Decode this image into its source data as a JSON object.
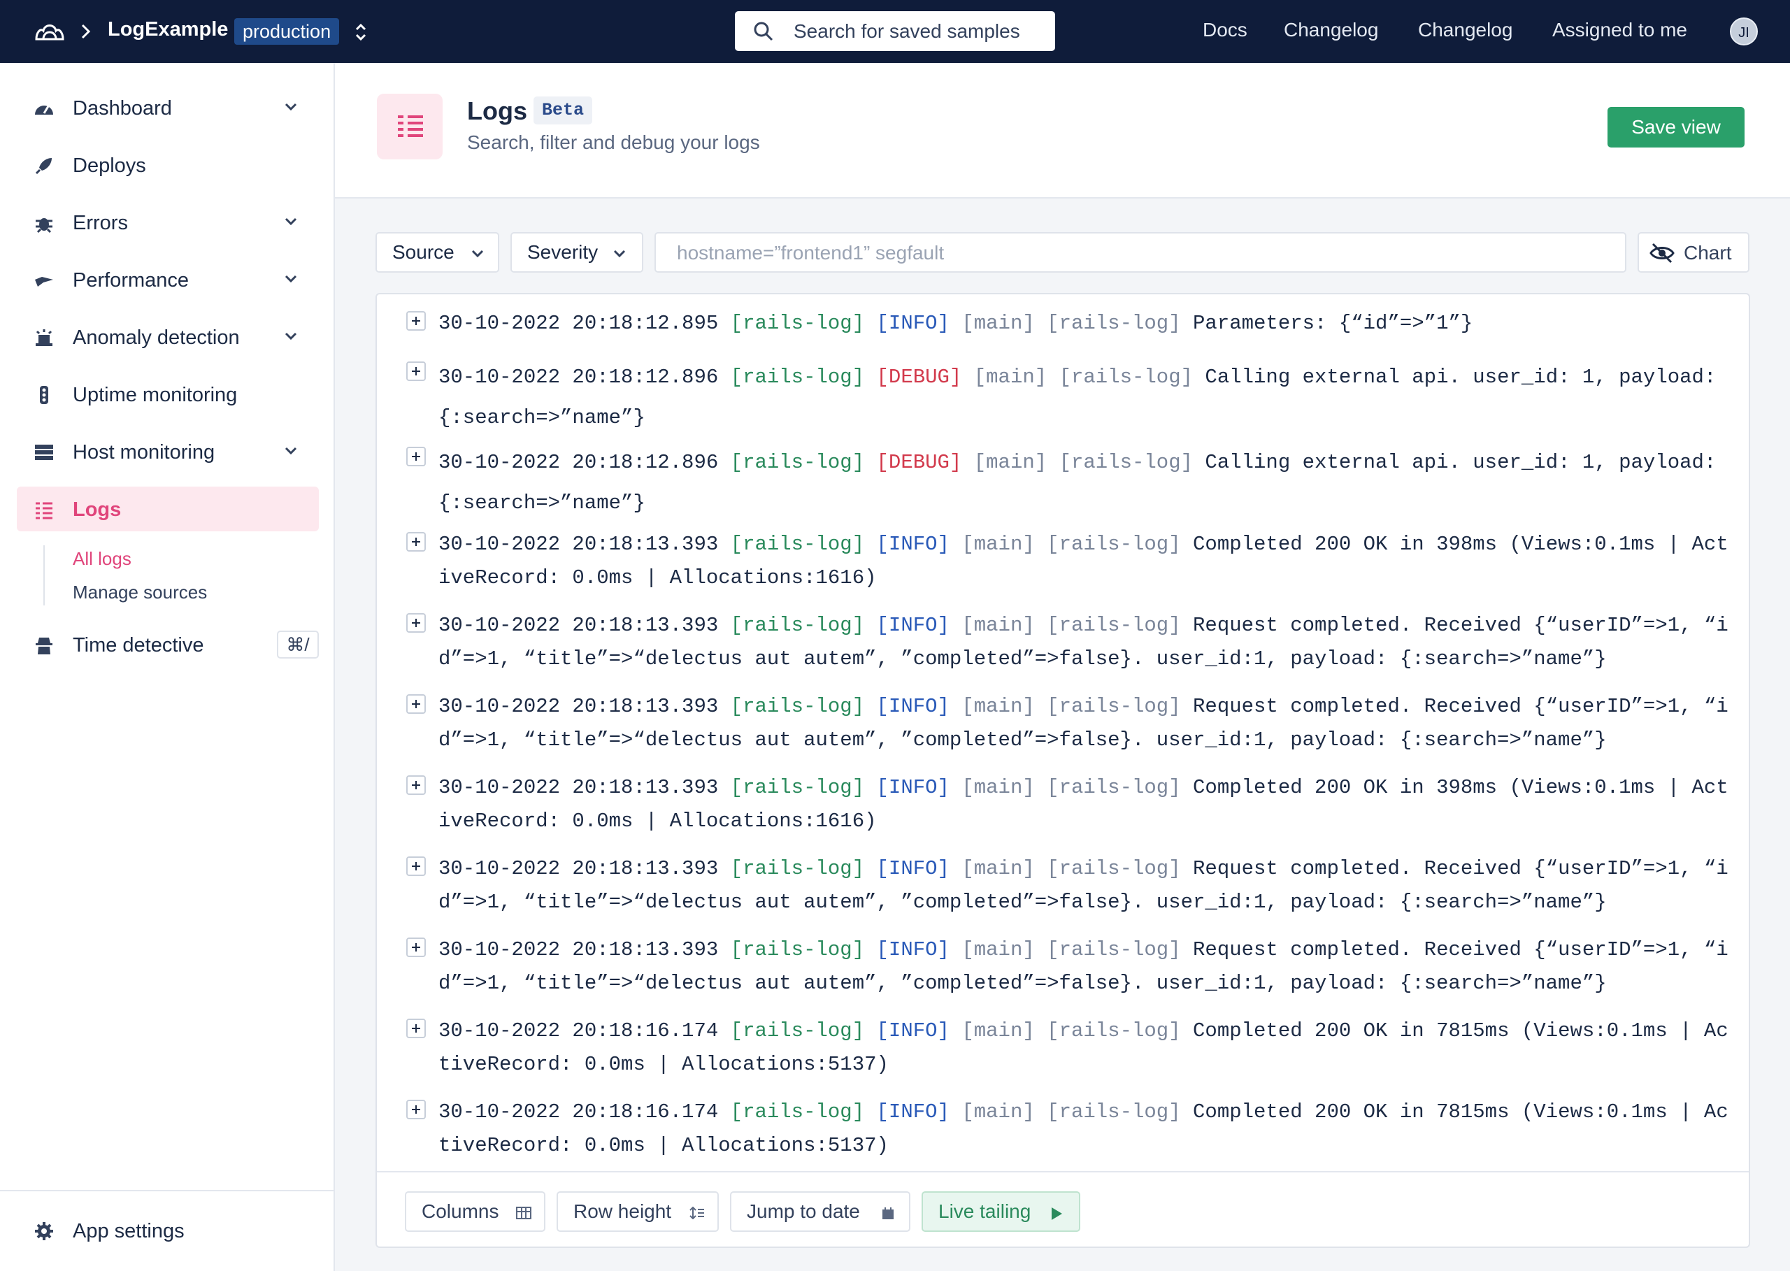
{
  "topbar": {
    "app_name": "LogExample",
    "environment": "production",
    "search_placeholder": "Search for saved samples",
    "nav": [
      "Docs",
      "Changelog",
      "Changelog",
      "Assigned to me"
    ],
    "avatar_initials": "JI"
  },
  "sidebar": {
    "items": [
      {
        "label": "Dashboard",
        "icon": "dashboard-icon",
        "has_chevron": true
      },
      {
        "label": "Deploys",
        "icon": "rocket-icon",
        "has_chevron": false
      },
      {
        "label": "Errors",
        "icon": "bug-icon",
        "has_chevron": true
      },
      {
        "label": "Performance",
        "icon": "performance-icon",
        "has_chevron": true
      },
      {
        "label": "Anomaly detection",
        "icon": "siren-icon",
        "has_chevron": true
      },
      {
        "label": "Uptime monitoring",
        "icon": "traffic-light-icon",
        "has_chevron": false
      },
      {
        "label": "Host monitoring",
        "icon": "server-icon",
        "has_chevron": true
      },
      {
        "label": "Logs",
        "icon": "logs-icon",
        "has_chevron": false,
        "active": true
      },
      {
        "label": "Time detective",
        "icon": "detective-icon",
        "has_chevron": false,
        "shortcut": "⌘/"
      }
    ],
    "logs_subnav": [
      "All logs",
      "Manage sources"
    ],
    "app_settings": "App settings"
  },
  "header": {
    "title": "Logs",
    "badge": "Beta",
    "subtitle": "Search, filter and debug your logs",
    "save_label": "Save view"
  },
  "filters": {
    "source_label": "Source",
    "severity_label": "Severity",
    "query_placeholder": "hostname=”frontend1” segfault",
    "chart_label": "Chart"
  },
  "colors": {
    "accent": "#e0457b",
    "topbar_bg": "#0f1c3a",
    "primary_button": "#2aa06a",
    "info": "#2a5ab8",
    "debug": "#d23a4c",
    "source": "#2a8a5c"
  },
  "logs": [
    {
      "ts": "30-10-2022 20:18:12.895",
      "source": "[rails-log]",
      "level": "[INFO]",
      "thread": "[main]",
      "tag": "[rails-log]",
      "message": "Parameters: {“id”=>”1”}"
    },
    {
      "ts": "30-10-2022 20:18:12.896",
      "source": "[rails-log]",
      "level": "[DEBUG]",
      "thread": "[main]",
      "tag": "[rails-log]",
      "message": "Calling external api. user_id: 1, payload: {:search=>”name”}"
    },
    {
      "ts": "30-10-2022 20:18:12.896",
      "source": "[rails-log]",
      "level": "[DEBUG]",
      "thread": "[main]",
      "tag": "[rails-log]",
      "message": "Calling external api. user_id: 1, payload: {:search=>”name”}"
    },
    {
      "ts": "30-10-2022 20:18:13.393",
      "source": "[rails-log]",
      "level": "[INFO]",
      "thread": "[main]",
      "tag": "[rails-log]",
      "message": "Completed 200 OK in 398ms (Views:0.1ms | ActiveRecord: 0.0ms | Allocations:1616)"
    },
    {
      "ts": "30-10-2022 20:18:13.393",
      "source": "[rails-log]",
      "level": "[INFO]",
      "thread": "[main]",
      "tag": "[rails-log]",
      "message": "Request completed. Received {“userID”=>1, “id”=>1, “title”=>“delectus aut autem”, ”completed”=>false}. user_id:1, payload: {:search=>”name”}"
    },
    {
      "ts": "30-10-2022 20:18:13.393",
      "source": "[rails-log]",
      "level": "[INFO]",
      "thread": "[main]",
      "tag": "[rails-log]",
      "message": "Request completed. Received {“userID”=>1, “id”=>1, “title”=>“delectus aut autem”, ”completed”=>false}. user_id:1, payload: {:search=>”name”}"
    },
    {
      "ts": "30-10-2022 20:18:13.393",
      "source": "[rails-log]",
      "level": "[INFO]",
      "thread": "[main]",
      "tag": "[rails-log]",
      "message": "Completed 200 OK in 398ms (Views:0.1ms | ActiveRecord: 0.0ms | Allocations:1616)"
    },
    {
      "ts": "30-10-2022 20:18:13.393",
      "source": "[rails-log]",
      "level": "[INFO]",
      "thread": "[main]",
      "tag": "[rails-log]",
      "message": "Request completed. Received {“userID”=>1, “id”=>1, “title”=>“delectus aut autem”, ”completed”=>false}. user_id:1, payload: {:search=>”name”}"
    },
    {
      "ts": "30-10-2022 20:18:13.393",
      "source": "[rails-log]",
      "level": "[INFO]",
      "thread": "[main]",
      "tag": "[rails-log]",
      "message": "Request completed. Received {“userID”=>1, “id”=>1, “title”=>“delectus aut autem”, ”completed”=>false}. user_id:1, payload: {:search=>”name”}"
    },
    {
      "ts": "30-10-2022 20:18:16.174",
      "source": "[rails-log]",
      "level": "[INFO]",
      "thread": "[main]",
      "tag": "[rails-log]",
      "message": "Completed 200 OK in 7815ms (Views:0.1ms | ActiveRecord: 0.0ms | Allocations:5137)"
    },
    {
      "ts": "30-10-2022 20:18:16.174",
      "source": "[rails-log]",
      "level": "[INFO]",
      "thread": "[main]",
      "tag": "[rails-log]",
      "message": "Completed 200 OK in 7815ms (Views:0.1ms | ActiveRecord: 0.0ms | Allocations:5137)"
    }
  ],
  "footer": {
    "columns_label": "Columns",
    "row_height_label": "Row height",
    "jump_label": "Jump to date",
    "live_label": "Live tailing"
  }
}
